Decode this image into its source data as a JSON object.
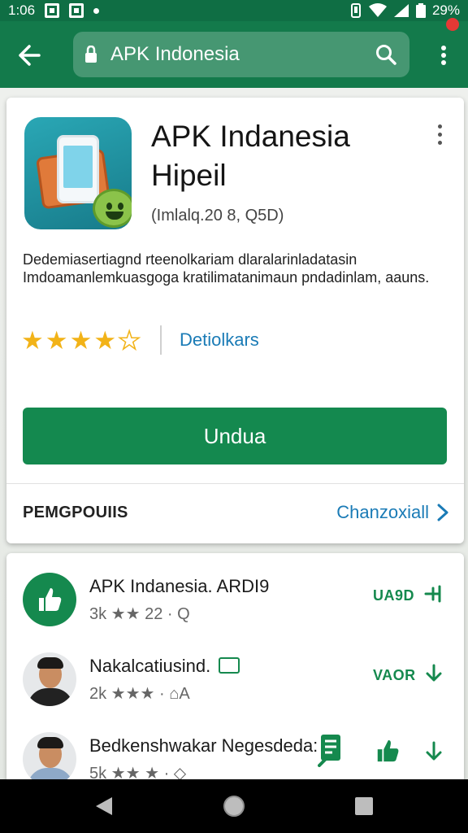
{
  "status_bar": {
    "time": "1:06",
    "battery": "29%"
  },
  "toolbar": {
    "search_query": "APK Indonesia"
  },
  "app": {
    "title_line1": "APK Indanesia",
    "title_line2": "Hipeil",
    "meta": "(Imlalq.20 8, Q5D)",
    "description": "Dedemiasertiagnd rteenolkariam dlaralarinladatasin Imdoamanlemkuasgoga kratilimatanimaun pndadinlam, aauns.",
    "rating": 4,
    "rating_max": 5,
    "details_label": "Detiolkars",
    "install_label": "Undua"
  },
  "section": {
    "title": "PEMGPOUIIS",
    "link_label": "Chanzoxiall"
  },
  "list": {
    "items": [
      {
        "title": "APK Indanesia. ARDI9",
        "sub": "3k ★★ 22 · Q",
        "action": "UA9D"
      },
      {
        "title": "Nakalcatiusind.",
        "sub": "2k ★★★ · ⌂A",
        "action": "VAOR"
      },
      {
        "title": "Bedkenshwakar Negesdeda:",
        "sub": "5k ★★ ★ · ◇"
      }
    ]
  },
  "colors": {
    "toolbar": "#137a4b",
    "status_bar": "#0f6e44",
    "accent_green": "#14894f",
    "link_blue": "#1a7bb6",
    "star": "#f2b318"
  }
}
